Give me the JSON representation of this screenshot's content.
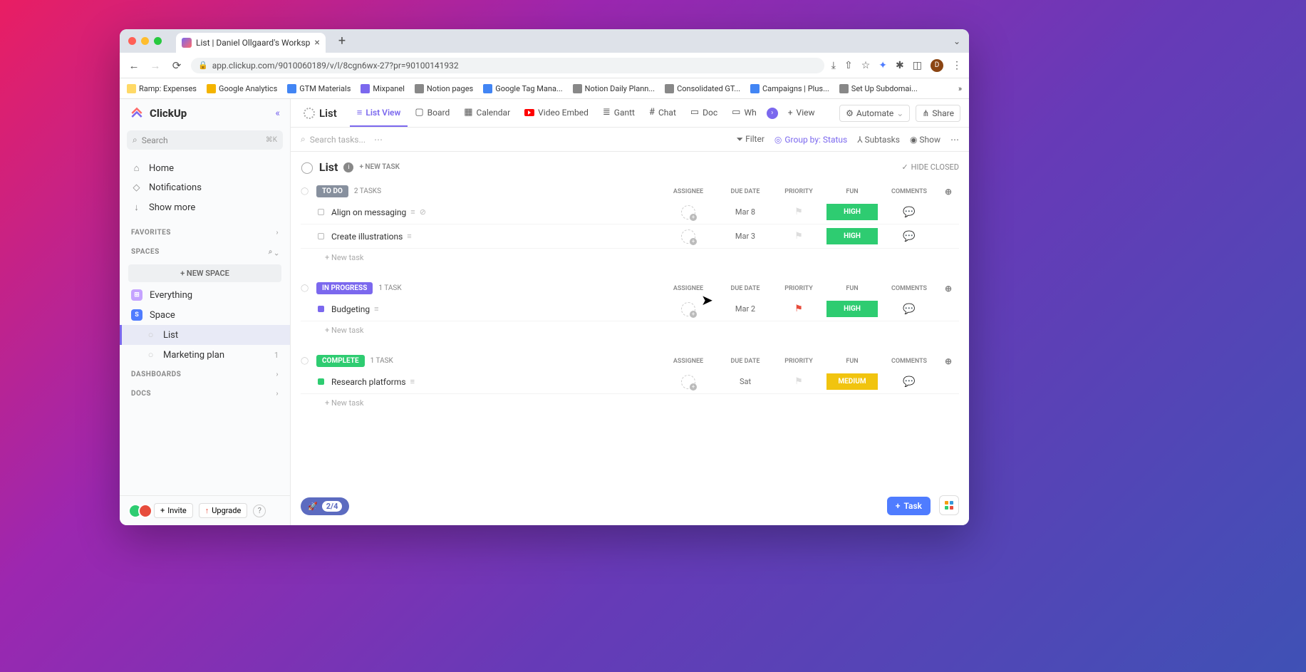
{
  "browser": {
    "tab_title": "List | Daniel Ollgaard's Worksp",
    "url": "app.clickup.com/9010060189/v/l/8cgn6wx-27?pr=90100141932",
    "bookmarks": [
      {
        "label": "Ramp: Expenses",
        "color": "#ffd966"
      },
      {
        "label": "Google Analytics",
        "color": "#f4b400"
      },
      {
        "label": "GTM Materials",
        "color": "#4285f4"
      },
      {
        "label": "Mixpanel",
        "color": "#7b68ee"
      },
      {
        "label": "Notion pages",
        "color": "#888"
      },
      {
        "label": "Google Tag Mana...",
        "color": "#4285f4"
      },
      {
        "label": "Notion Daily Plann...",
        "color": "#888"
      },
      {
        "label": "Consolidated GT...",
        "color": "#888"
      },
      {
        "label": "Campaigns | Plus...",
        "color": "#4285f4"
      },
      {
        "label": "Set Up Subdomai...",
        "color": "#888"
      }
    ],
    "avatar_letter": "D"
  },
  "sidebar": {
    "brand": "ClickUp",
    "search_placeholder": "Search",
    "search_shortcut": "⌘K",
    "nav": [
      {
        "label": "Home",
        "icon": "⌂"
      },
      {
        "label": "Notifications",
        "icon": "◇"
      },
      {
        "label": "Show more",
        "icon": "↓"
      }
    ],
    "favorites_label": "FAVORITES",
    "spaces_label": "SPACES",
    "new_space_label": "+  NEW SPACE",
    "spaces": [
      {
        "label": "Everything",
        "badge_color": "#c5a3ff",
        "badge_text": "⊞"
      },
      {
        "label": "Space",
        "badge_color": "#4f7cff",
        "badge_text": "S"
      }
    ],
    "lists": [
      {
        "label": "List",
        "active": true
      },
      {
        "label": "Marketing plan",
        "count": "1"
      }
    ],
    "dashboards_label": "DASHBOARDS",
    "docs_label": "DOCS",
    "invite_label": "Invite",
    "upgrade_label": "Upgrade"
  },
  "views": {
    "title": "List",
    "tabs": [
      {
        "label": "List View",
        "icon": "≡",
        "active": true
      },
      {
        "label": "Board",
        "icon": "▢"
      },
      {
        "label": "Calendar",
        "icon": "▦"
      },
      {
        "label": "Video Embed",
        "icon": "yt"
      },
      {
        "label": "Gantt",
        "icon": "≣"
      },
      {
        "label": "Chat",
        "icon": "#"
      },
      {
        "label": "Doc",
        "icon": "▭"
      },
      {
        "label": "Wh",
        "icon": "▭"
      }
    ],
    "add_view_label": "View",
    "automate_label": "Automate",
    "share_label": "Share"
  },
  "toolbar": {
    "search_placeholder": "Search tasks...",
    "filter_label": "Filter",
    "group_by_label": "Group by: Status",
    "subtasks_label": "Subtasks",
    "show_label": "Show"
  },
  "list": {
    "title": "List",
    "new_task_header": "+ NEW TASK",
    "hide_closed_label": "HIDE CLOSED",
    "columns": {
      "assignee": "ASSIGNEE",
      "due_date": "DUE DATE",
      "priority": "PRIORITY",
      "fun": "FUN",
      "comments": "COMMENTS"
    },
    "new_task_row": "+ New task",
    "groups": [
      {
        "status": "TO DO",
        "status_class": "status-todo",
        "count": "2 TASKS",
        "tasks": [
          {
            "name": "Align on messaging",
            "due": "Mar 8",
            "priority": "",
            "fun": "HIGH",
            "fun_class": "fun-high",
            "has_desc": true,
            "has_attach": true,
            "dot": ""
          },
          {
            "name": "Create illustrations",
            "due": "Mar 3",
            "priority": "",
            "fun": "HIGH",
            "fun_class": "fun-high",
            "has_desc": true,
            "dot": ""
          }
        ]
      },
      {
        "status": "IN PROGRESS",
        "status_class": "status-progress",
        "count": "1 TASK",
        "tasks": [
          {
            "name": "Budgeting",
            "due": "Mar 2",
            "priority": "red",
            "fun": "HIGH",
            "fun_class": "fun-high",
            "has_desc": true,
            "dot": "prog"
          }
        ]
      },
      {
        "status": "COMPLETE",
        "status_class": "status-complete",
        "count": "1 TASK",
        "tasks": [
          {
            "name": "Research platforms",
            "due": "Sat",
            "priority": "",
            "fun": "MEDIUM",
            "fun_class": "fun-medium",
            "has_desc": true,
            "dot": "comp"
          }
        ]
      }
    ]
  },
  "footer": {
    "onboard_count": "2/4",
    "task_label": "Task"
  }
}
